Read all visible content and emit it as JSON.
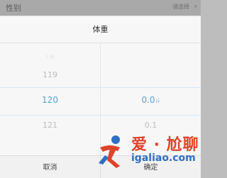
{
  "background_row": {
    "label": "性别",
    "value": "请选择",
    "chevron": "›"
  },
  "dialog": {
    "title": "体重",
    "left_column": {
      "above_2": "118",
      "above_1": "119",
      "selected": "120",
      "below_1": "121"
    },
    "right_column": {
      "selected": "0.0",
      "selected_unit": "斤",
      "below_1": "0.1"
    },
    "cancel_label": "取消",
    "confirm_label": "确定"
  },
  "watermark": {
    "brand": "爱 · 尬聊",
    "url": "igaliao.com"
  },
  "colors": {
    "accent": "#5aa1d4",
    "watermark_red": "#e1422a",
    "watermark_blue": "#2f6fc4"
  }
}
